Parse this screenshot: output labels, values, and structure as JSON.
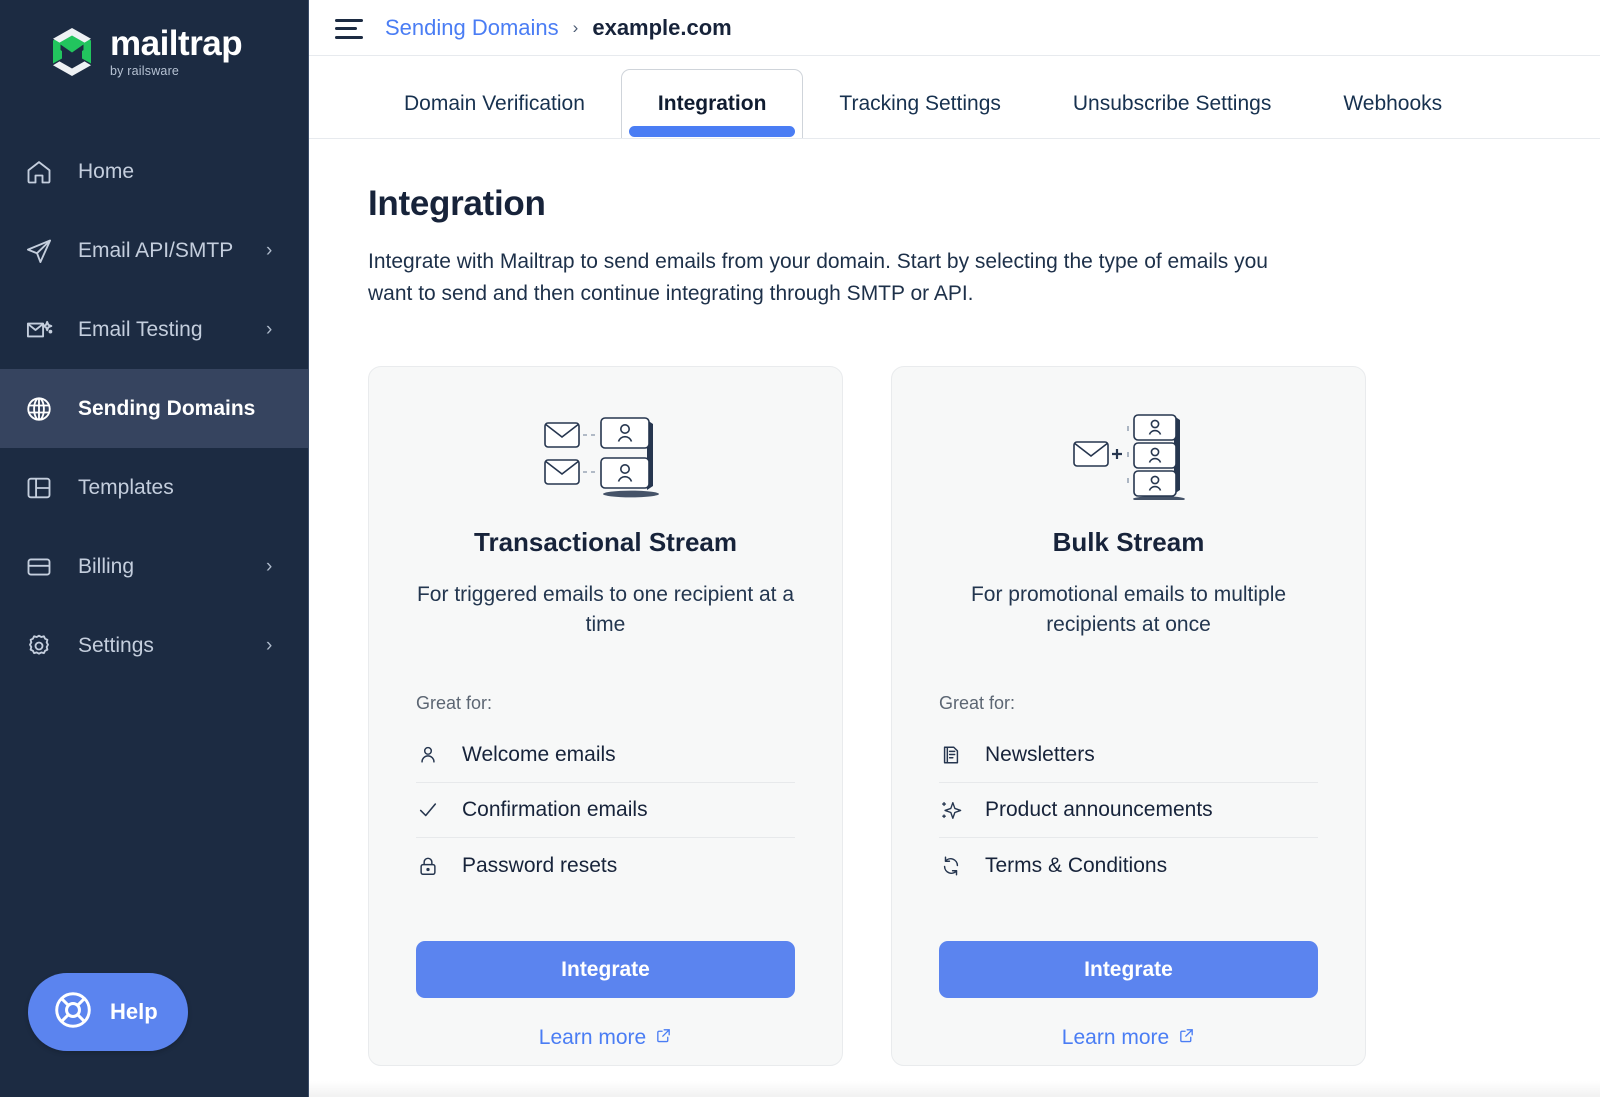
{
  "brand": {
    "name": "mailtrap",
    "tagline": "by railsware",
    "logo_green": "#22c55e",
    "sidebar_bg": "#1c2b42",
    "accent_blue": "#5b84ef",
    "link_blue": "#4a7df4"
  },
  "sidebar": {
    "items": [
      {
        "label": "Home",
        "icon": "home-icon",
        "chevron": "",
        "active": false
      },
      {
        "label": "Email API/SMTP",
        "icon": "paper-plane-icon",
        "chevron": "›",
        "active": false
      },
      {
        "label": "Email Testing",
        "icon": "envelope-sparkle-icon",
        "chevron": "›",
        "active": false
      },
      {
        "label": "Sending Domains",
        "icon": "globe-icon",
        "chevron": "",
        "active": true
      },
      {
        "label": "Templates",
        "icon": "layout-icon",
        "chevron": "",
        "active": false
      },
      {
        "label": "Billing",
        "icon": "credit-card-icon",
        "chevron": "›",
        "active": false
      },
      {
        "label": "Settings",
        "icon": "gear-icon",
        "chevron": "›",
        "active": false
      }
    ],
    "help": {
      "label": "Help",
      "icon": "lifebuoy-icon"
    }
  },
  "topbar": {
    "menu_icon": "hamburger-icon",
    "breadcrumb": {
      "parent": "Sending Domains",
      "separator": "›",
      "current": "example.com"
    }
  },
  "tabs": [
    {
      "label": "Domain Verification",
      "active": false
    },
    {
      "label": "Integration",
      "active": true
    },
    {
      "label": "Tracking Settings",
      "active": false
    },
    {
      "label": "Unsubscribe Settings",
      "active": false
    },
    {
      "label": "Webhooks",
      "active": false
    }
  ],
  "page": {
    "title": "Integration",
    "description": "Integrate with Mailtrap to send emails from your domain. Start by selecting the type of emails you want to send and then continue integrating through SMTP or API."
  },
  "cards": [
    {
      "illustration": "two-envelopes-to-two-recipients-illustration",
      "title": "Transactional Stream",
      "subtitle": "For triggered emails to one recipient at a time",
      "great_for_label": "Great for:",
      "features": [
        {
          "label": "Welcome emails",
          "icon": "person-icon"
        },
        {
          "label": "Confirmation emails",
          "icon": "check-icon"
        },
        {
          "label": "Password resets",
          "icon": "lock-icon"
        }
      ],
      "button_label": "Integrate",
      "link_label": "Learn more",
      "link_icon": "external-link-icon"
    },
    {
      "illustration": "one-envelope-to-three-recipients-illustration",
      "title": "Bulk Stream",
      "subtitle": "For promotional emails to multiple recipients at once",
      "great_for_label": "Great for:",
      "features": [
        {
          "label": "Newsletters",
          "icon": "document-icon"
        },
        {
          "label": "Product announcements",
          "icon": "sparkle-icon"
        },
        {
          "label": "Terms & Conditions",
          "icon": "refresh-icon"
        }
      ],
      "button_label": "Integrate",
      "link_label": "Learn more",
      "link_icon": "external-link-icon"
    }
  ]
}
